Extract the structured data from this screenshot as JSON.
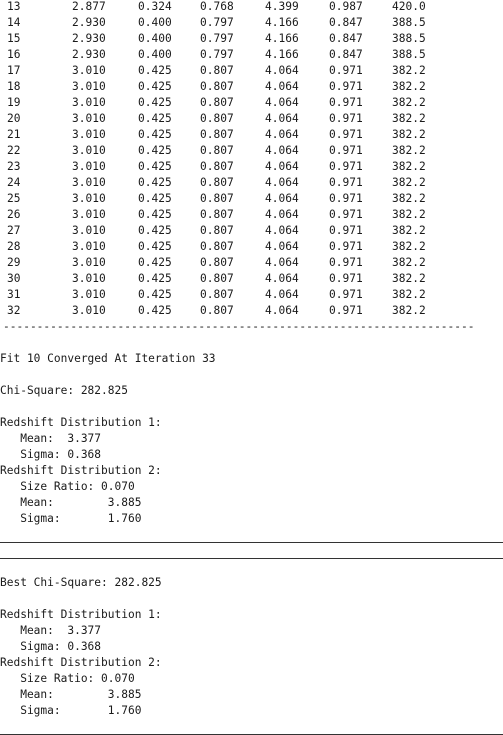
{
  "table": {
    "rows": [
      [
        "13",
        "2.877",
        "0.324",
        "0.768",
        "4.399",
        "0.987",
        "420.0"
      ],
      [
        "14",
        "2.930",
        "0.400",
        "0.797",
        "4.166",
        "0.847",
        "388.5"
      ],
      [
        "15",
        "2.930",
        "0.400",
        "0.797",
        "4.166",
        "0.847",
        "388.5"
      ],
      [
        "16",
        "2.930",
        "0.400",
        "0.797",
        "4.166",
        "0.847",
        "388.5"
      ],
      [
        "17",
        "3.010",
        "0.425",
        "0.807",
        "4.064",
        "0.971",
        "382.2"
      ],
      [
        "18",
        "3.010",
        "0.425",
        "0.807",
        "4.064",
        "0.971",
        "382.2"
      ],
      [
        "19",
        "3.010",
        "0.425",
        "0.807",
        "4.064",
        "0.971",
        "382.2"
      ],
      [
        "20",
        "3.010",
        "0.425",
        "0.807",
        "4.064",
        "0.971",
        "382.2"
      ],
      [
        "21",
        "3.010",
        "0.425",
        "0.807",
        "4.064",
        "0.971",
        "382.2"
      ],
      [
        "22",
        "3.010",
        "0.425",
        "0.807",
        "4.064",
        "0.971",
        "382.2"
      ],
      [
        "23",
        "3.010",
        "0.425",
        "0.807",
        "4.064",
        "0.971",
        "382.2"
      ],
      [
        "24",
        "3.010",
        "0.425",
        "0.807",
        "4.064",
        "0.971",
        "382.2"
      ],
      [
        "25",
        "3.010",
        "0.425",
        "0.807",
        "4.064",
        "0.971",
        "382.2"
      ],
      [
        "26",
        "3.010",
        "0.425",
        "0.807",
        "4.064",
        "0.971",
        "382.2"
      ],
      [
        "27",
        "3.010",
        "0.425",
        "0.807",
        "4.064",
        "0.971",
        "382.2"
      ],
      [
        "28",
        "3.010",
        "0.425",
        "0.807",
        "4.064",
        "0.971",
        "382.2"
      ],
      [
        "29",
        "3.010",
        "0.425",
        "0.807",
        "4.064",
        "0.971",
        "382.2"
      ],
      [
        "30",
        "3.010",
        "0.425",
        "0.807",
        "4.064",
        "0.971",
        "382.2"
      ],
      [
        "31",
        "3.010",
        "0.425",
        "0.807",
        "4.064",
        "0.971",
        "382.2"
      ],
      [
        "32",
        "3.010",
        "0.425",
        "0.807",
        "4.064",
        "0.971",
        "382.2"
      ]
    ],
    "separator": "----------------------------------------------------------------------------------------"
  },
  "fit_block": {
    "converged": "Fit 10 Converged At Iteration 33",
    "chi_square": "Chi-Square: 282.825",
    "dist1_title": "Redshift Distribution 1:",
    "dist1_mean": "   Mean:  3.377",
    "dist1_sigma": "   Sigma: 0.368",
    "dist2_title": "Redshift Distribution 2:",
    "dist2_ratio": "   Size Ratio: 0.070",
    "dist2_mean": "   Mean:        3.885",
    "dist2_sigma": "   Sigma:       1.760"
  },
  "best_block": {
    "best_chi_square": "Best Chi-Square: 282.825",
    "dist1_title": "Redshift Distribution 1:",
    "dist1_mean": "   Mean:  3.377",
    "dist1_sigma": "   Sigma: 0.368",
    "dist2_title": "Redshift Distribution 2:",
    "dist2_ratio": "   Size Ratio: 0.070",
    "dist2_mean": "   Mean:        3.885",
    "dist2_sigma": "   Sigma:       1.760"
  }
}
